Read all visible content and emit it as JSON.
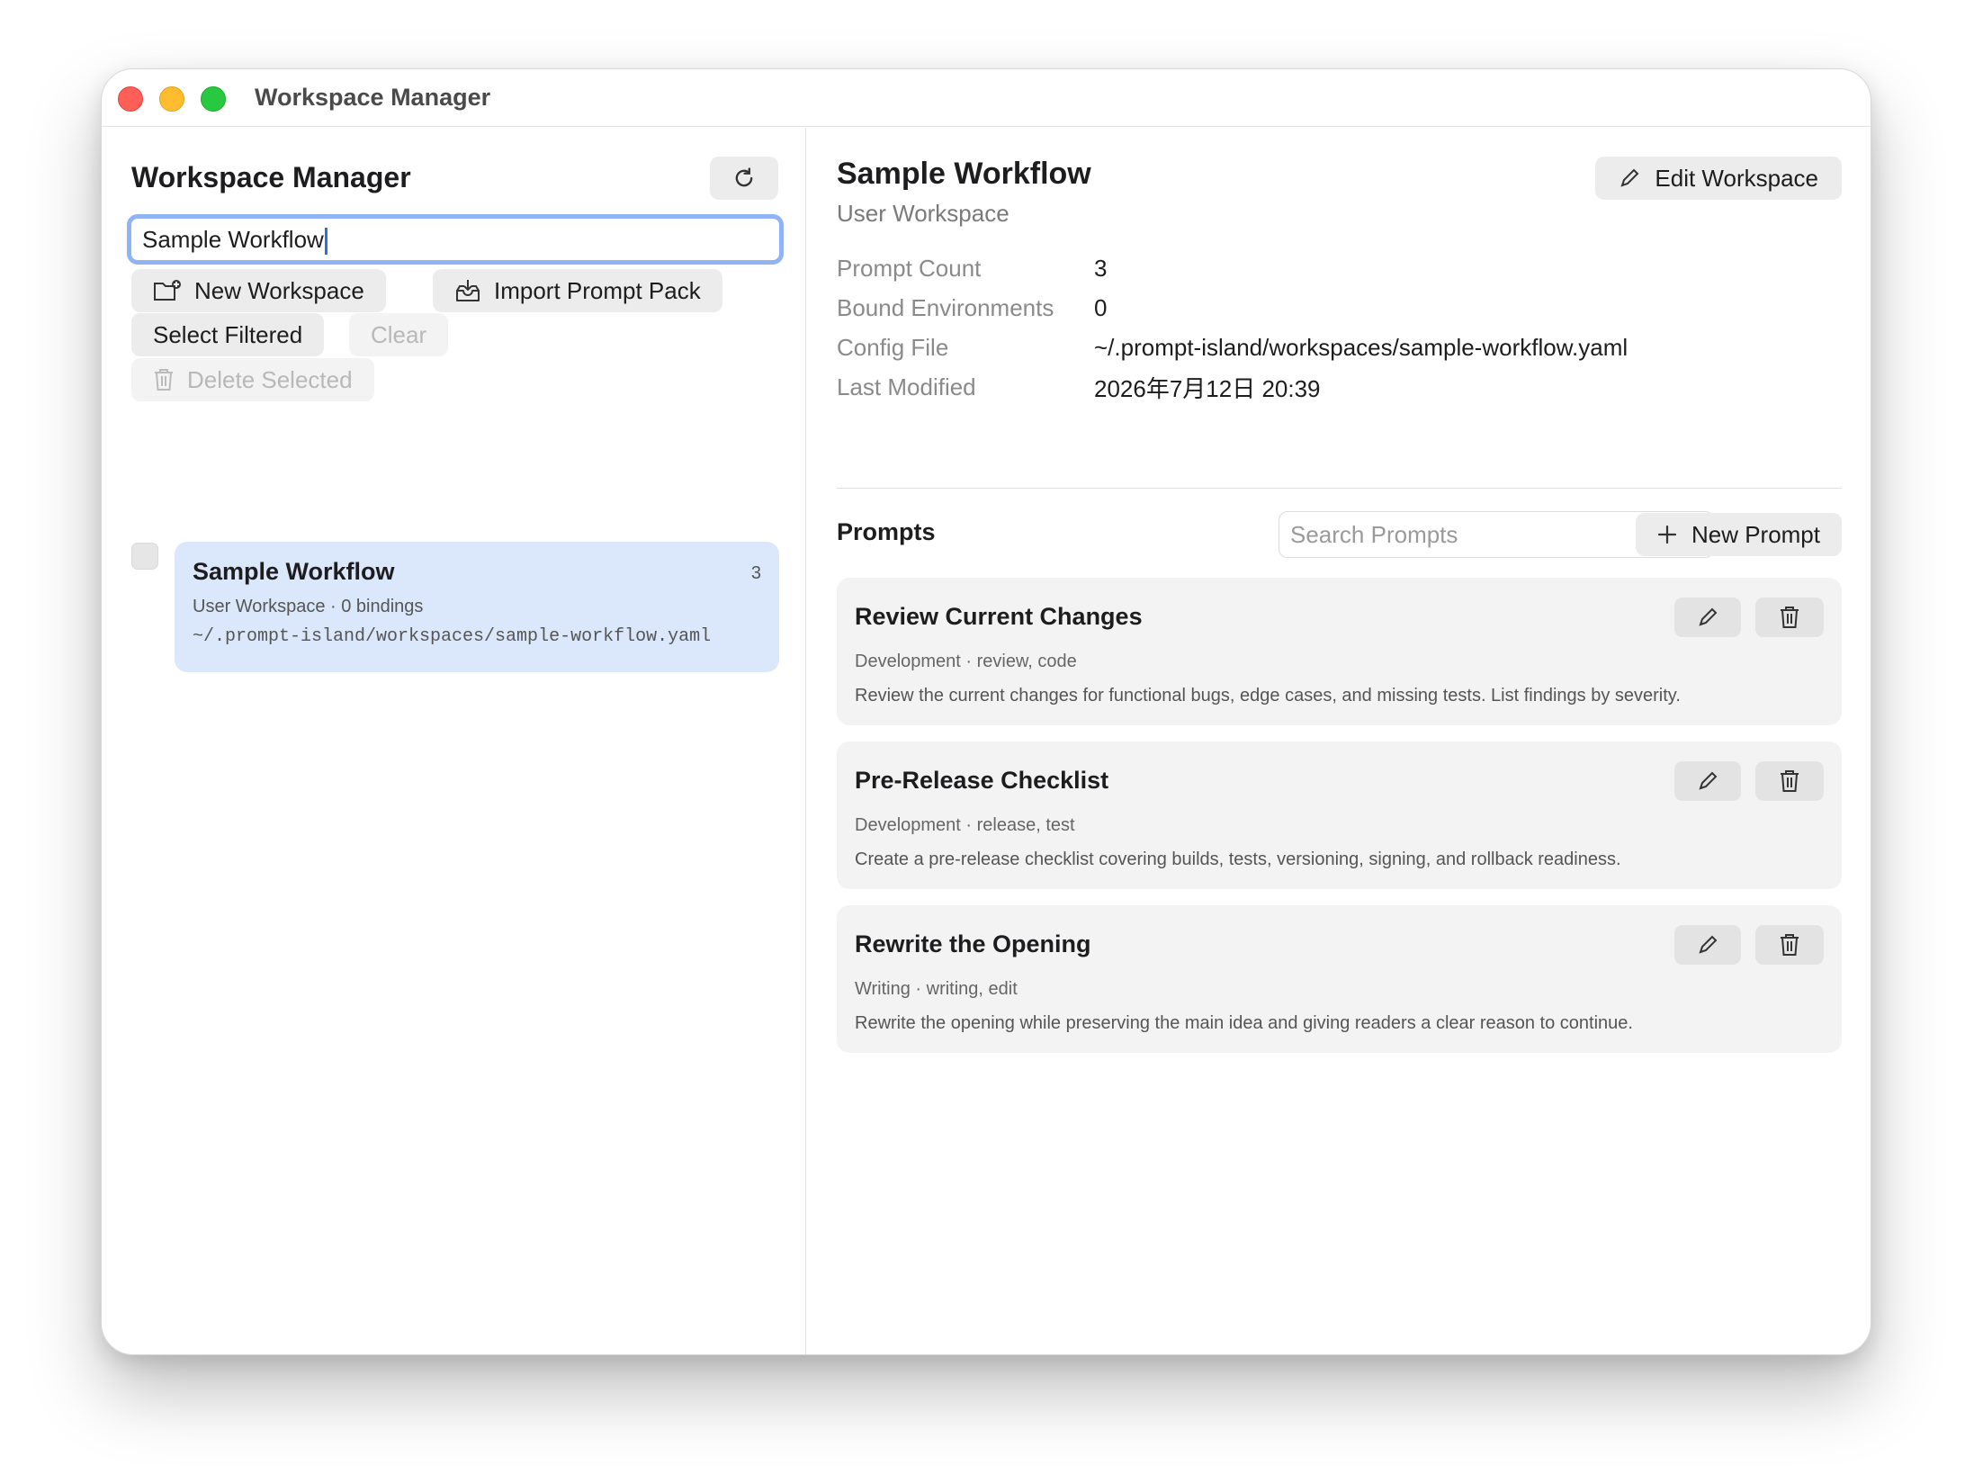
{
  "window": {
    "title": "Workspace Manager"
  },
  "sidebar": {
    "title": "Workspace Manager",
    "search_value": "Sample Workflow",
    "buttons": {
      "new_workspace": "New Workspace",
      "import_prompt_pack": "Import Prompt Pack",
      "select_filtered": "Select Filtered",
      "clear": "Clear",
      "delete_selected": "Delete Selected"
    },
    "workspaces": [
      {
        "name": "Sample Workflow",
        "count": "3",
        "meta": "User Workspace · 0 bindings",
        "path": "~/.prompt-island/workspaces/sample-workflow.yaml"
      }
    ]
  },
  "main": {
    "title": "Sample Workflow",
    "subtitle": "User Workspace",
    "edit_label": "Edit Workspace",
    "info": [
      {
        "label": "Prompt Count",
        "value": "3"
      },
      {
        "label": "Bound Environments",
        "value": "0"
      },
      {
        "label": "Config File",
        "value": "~/.prompt-island/workspaces/sample-workflow.yaml"
      },
      {
        "label": "Last Modified",
        "value": "2026年7月12日 20:39"
      }
    ],
    "prompts_label": "Prompts",
    "search_placeholder": "Search Prompts",
    "new_prompt_label": "New Prompt",
    "prompts": [
      {
        "title": "Review Current Changes",
        "meta": "Development · review, code",
        "desc": "Review the current changes for functional bugs, edge cases, and missing tests. List findings by severity."
      },
      {
        "title": "Pre-Release Checklist",
        "meta": "Development · release, test",
        "desc": "Create a pre-release checklist covering builds, tests, versioning, signing, and rollback readiness."
      },
      {
        "title": "Rewrite the Opening",
        "meta": "Writing · writing, edit",
        "desc": "Rewrite the opening while preserving the main idea and giving readers a clear reason to continue."
      }
    ]
  }
}
